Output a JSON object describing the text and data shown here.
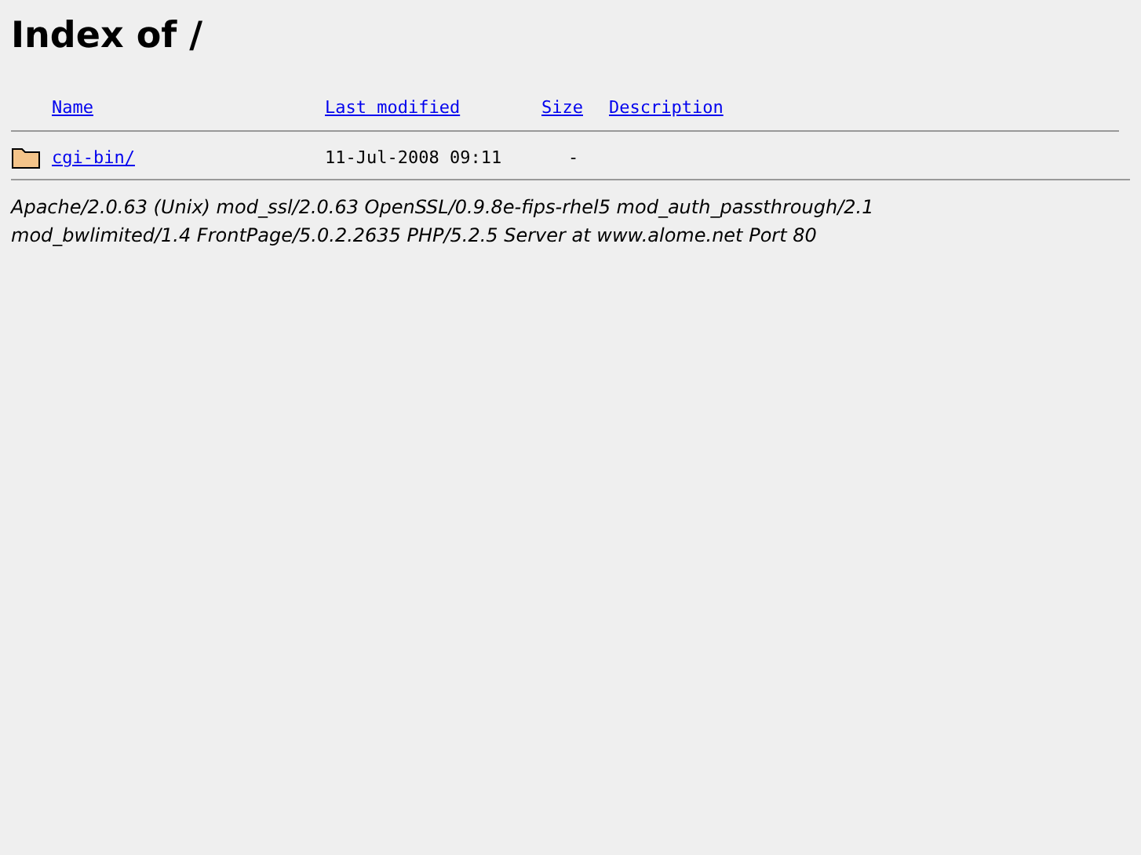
{
  "heading": "Index of /",
  "table": {
    "columns": [
      "Name",
      "Last modified",
      "Size",
      "Description"
    ],
    "rows": [
      {
        "kind": "folder",
        "name": "cgi-bin/",
        "last_modified": "11-Jul-2008 09:11",
        "size": "-"
      }
    ]
  },
  "address": "Apache/2.0.63 (Unix) mod_ssl/2.0.63 OpenSSL/0.9.8e-fips-rhel5 mod_auth_passthrough/2.1 mod_bwlimited/1.4 FrontPage/5.0.2.2635 PHP/5.2.5 Server at www.alome.net Port 80"
}
